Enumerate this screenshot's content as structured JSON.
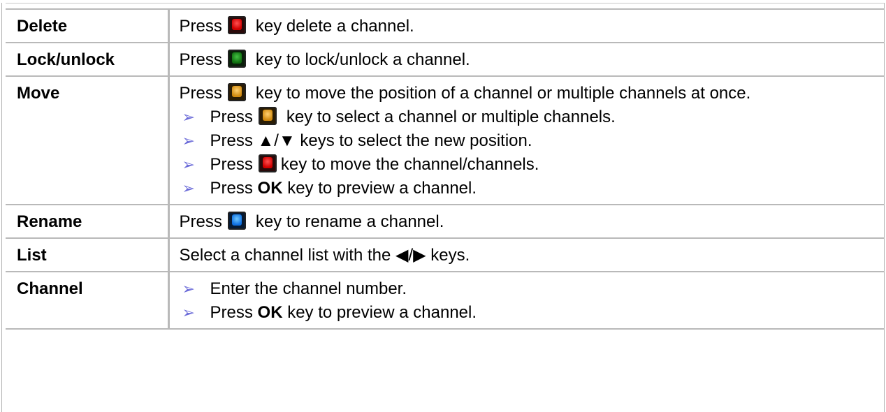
{
  "rows": {
    "delete": {
      "label": "Delete",
      "pre": "Press",
      "post": "key delete a channel.",
      "key_icon": "red-key-icon"
    },
    "lock": {
      "label": "Lock/unlock",
      "pre": "Press",
      "post": "key to lock/unlock a channel.",
      "key_icon": "green-key-icon"
    },
    "move": {
      "label": "Move",
      "pre": "Press",
      "post": "key to move the position of a channel or multiple channels at once.",
      "key_icon": "yellow-key-icon",
      "bullets": [
        {
          "pre": "Press",
          "post": "key to select a channel or multiple channels."
        },
        {
          "text": "Press ▲/▼ keys to select the new position."
        },
        {
          "pre": "Press",
          "post": "key to move the channel/channels."
        },
        {
          "pre": "Press",
          "bold": "OK",
          "post": "key to preview a channel."
        }
      ]
    },
    "rename": {
      "label": "Rename",
      "pre": "Press",
      "post": "key to rename a channel.",
      "key_icon": "blue-key-icon"
    },
    "list": {
      "label": "List",
      "text": "Select a channel list with the ◀/▶ keys."
    },
    "channel": {
      "label": "Channel",
      "bullets": [
        {
          "text": "Enter the channel number."
        },
        {
          "pre": "Press",
          "bold": "OK",
          "post": "key to preview a channel."
        }
      ]
    }
  },
  "bullet_glyph": "➢",
  "colors": {
    "red_key": "#e00000",
    "green_key": "#1a8a1a",
    "yellow_key": "#e0a020",
    "blue_key": "#2080f0",
    "border": "#b9b9b9",
    "bullet": "#6a6ad8"
  }
}
